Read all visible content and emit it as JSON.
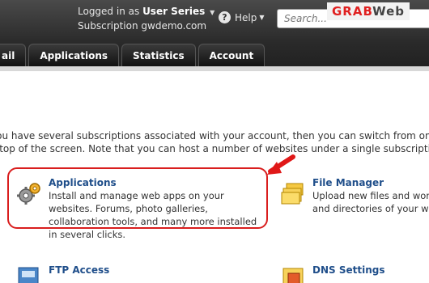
{
  "header": {
    "logged_in_prefix": "Logged in as",
    "user_name": "User Series",
    "subscription_prefix": "Subscription",
    "subscription_value": "gwdemo.com",
    "help_label": "Help",
    "search_placeholder": "Search...",
    "watermark_part1": "GRAB",
    "watermark_part2": "Web"
  },
  "tabs": [
    "ail",
    "Applications",
    "Statistics",
    "Account"
  ],
  "intro": {
    "line1": "you have several subscriptions associated with your account, then you can switch from one s",
    "line2": "e top of the screen. Note that you can host a number of websites under a single subscripti"
  },
  "cards": {
    "applications": {
      "title": "Applications",
      "desc": "Install and manage web apps on your websites. Forums, photo galleries, collaboration tools, and many more installed in several clicks.",
      "icon": "gears-icon"
    },
    "file_manager": {
      "title": "File Manager",
      "desc": "Upload new files and wor and directories of your w",
      "icon": "folders-icon"
    },
    "ftp_access": {
      "title": "FTP Access",
      "icon": "ftp-icon"
    },
    "dns_settings": {
      "title": "DNS Settings",
      "icon": "dns-icon"
    }
  },
  "colors": {
    "highlight": "#d91e1e",
    "link": "#1f4e8a",
    "header_bg": "#2a2a2a"
  }
}
